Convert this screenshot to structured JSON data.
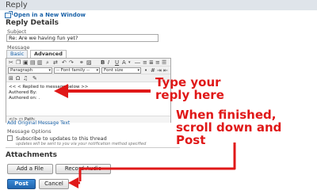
{
  "window": {
    "title": "Reply"
  },
  "links": {
    "open_new_window": "Open in a New Window",
    "add_original": "Add Original Message Text"
  },
  "section": {
    "reply_details": "Reply Details",
    "attachments": "Attachments"
  },
  "subject": {
    "label": "Subject",
    "value": "Re: Are we having fun yet?"
  },
  "message": {
    "label": "Message",
    "tabs": [
      {
        "label": "Basic"
      },
      {
        "label": "Advanced"
      }
    ],
    "toolbar": {
      "format_select": "Paragraph",
      "font_family_select": "-- Font family --",
      "font_size_select": "Font size"
    },
    "content": [
      "<< < Replied to message below >>",
      "Authored By:",
      "Authored on: ."
    ],
    "path_label": "Path:"
  },
  "message_options": {
    "label": "Message Options",
    "subscribe_label": "Subscribe to updates to this thread",
    "subscribe_hint": "updates will be sent to you via your notification method specified"
  },
  "buttons": {
    "add_file": "Add a File",
    "record_audio": "Record Audio",
    "post": "Post",
    "cancel": "Cancel"
  },
  "annotations": {
    "type_reply": [
      "Type your",
      "reply here"
    ],
    "when_finished": [
      "When finished,",
      "scroll down and",
      "Post"
    ]
  },
  "colors": {
    "annotation": "#e01818",
    "link": "#1a62a8",
    "post_button": "#2a72c0"
  }
}
